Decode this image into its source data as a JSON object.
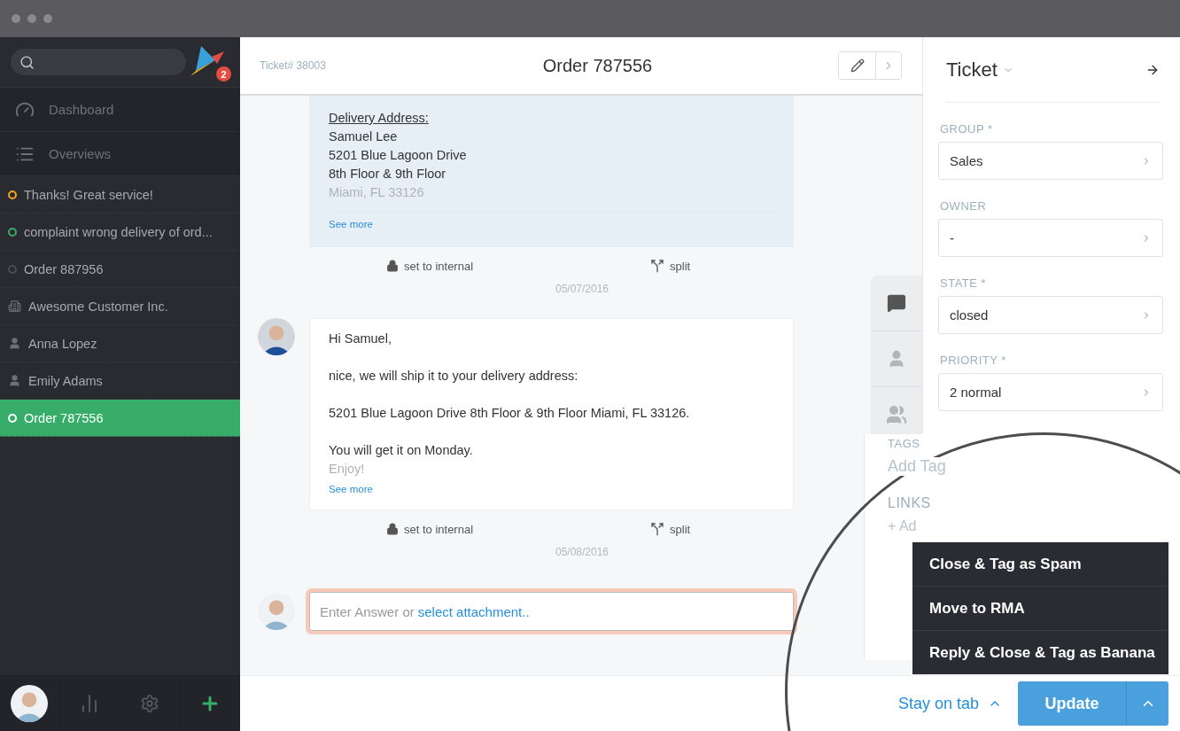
{
  "sidebar": {
    "notification_count": "2",
    "nav": [
      {
        "kind": "dashboard",
        "label": "Dashboard"
      },
      {
        "kind": "overviews",
        "label": "Overviews"
      }
    ],
    "tasks": [
      {
        "kind": "ticket",
        "label": "Thanks! Great service!",
        "color": "#f5a623",
        "selected": false
      },
      {
        "kind": "ticket",
        "label": "complaint wrong delivery of ord...",
        "color": "#38ad69",
        "selected": false
      },
      {
        "kind": "ticket",
        "label": "Order 887956",
        "color": "#4a4c52",
        "selected": false
      },
      {
        "kind": "organization",
        "label": "Awesome Customer Inc.",
        "selected": false
      },
      {
        "kind": "user",
        "label": "Anna Lopez",
        "selected": false
      },
      {
        "kind": "user",
        "label": "Emily Adams",
        "selected": false
      },
      {
        "kind": "ticket",
        "label": "Order 787556",
        "color": "#ffffff",
        "selected": true
      }
    ]
  },
  "ticket": {
    "number": "Ticket# 38003",
    "title": "Order 787556"
  },
  "articles": [
    {
      "kind": "address",
      "heading": "Delivery Address:",
      "lines": [
        "Samuel Lee",
        "5201 Blue Lagoon Drive",
        "8th Floor & 9th Floor"
      ],
      "faded": "Miami, FL 33126",
      "see_more": "See more",
      "actions": [
        "set to internal",
        "split"
      ],
      "date": "05/07/2016"
    },
    {
      "kind": "reply",
      "paragraphs": [
        "Hi Samuel,",
        "nice, we will ship it to your delivery address:",
        "5201 Blue Lagoon Drive 8th Floor & 9th Floor Miami, FL 33126.",
        "You will get it on Monday."
      ],
      "faded": "Enjoy!",
      "see_more": "See more",
      "actions": [
        "set to internal",
        "split"
      ],
      "date": "05/08/2016"
    }
  ],
  "reply": {
    "placeholder": "Enter Answer or",
    "attachment_link": "select attachment.."
  },
  "panel": {
    "title": "Ticket",
    "fields": [
      {
        "label": "GROUP *",
        "value": "Sales"
      },
      {
        "label": "OWNER",
        "value": "-"
      },
      {
        "label": "STATE *",
        "value": "closed"
      },
      {
        "label": "PRIORITY *",
        "value": "2 normal"
      }
    ],
    "tags_label": "TAGS",
    "add_tag": "Add Tag",
    "links_label": "LINKS",
    "add_link": "+ Ad"
  },
  "macro_menu": [
    "Close & Tag as Spam",
    "Move to RMA",
    "Reply & Close & Tag as Banana"
  ],
  "footer": {
    "stay_on_tab": "Stay on tab",
    "update": "Update"
  }
}
